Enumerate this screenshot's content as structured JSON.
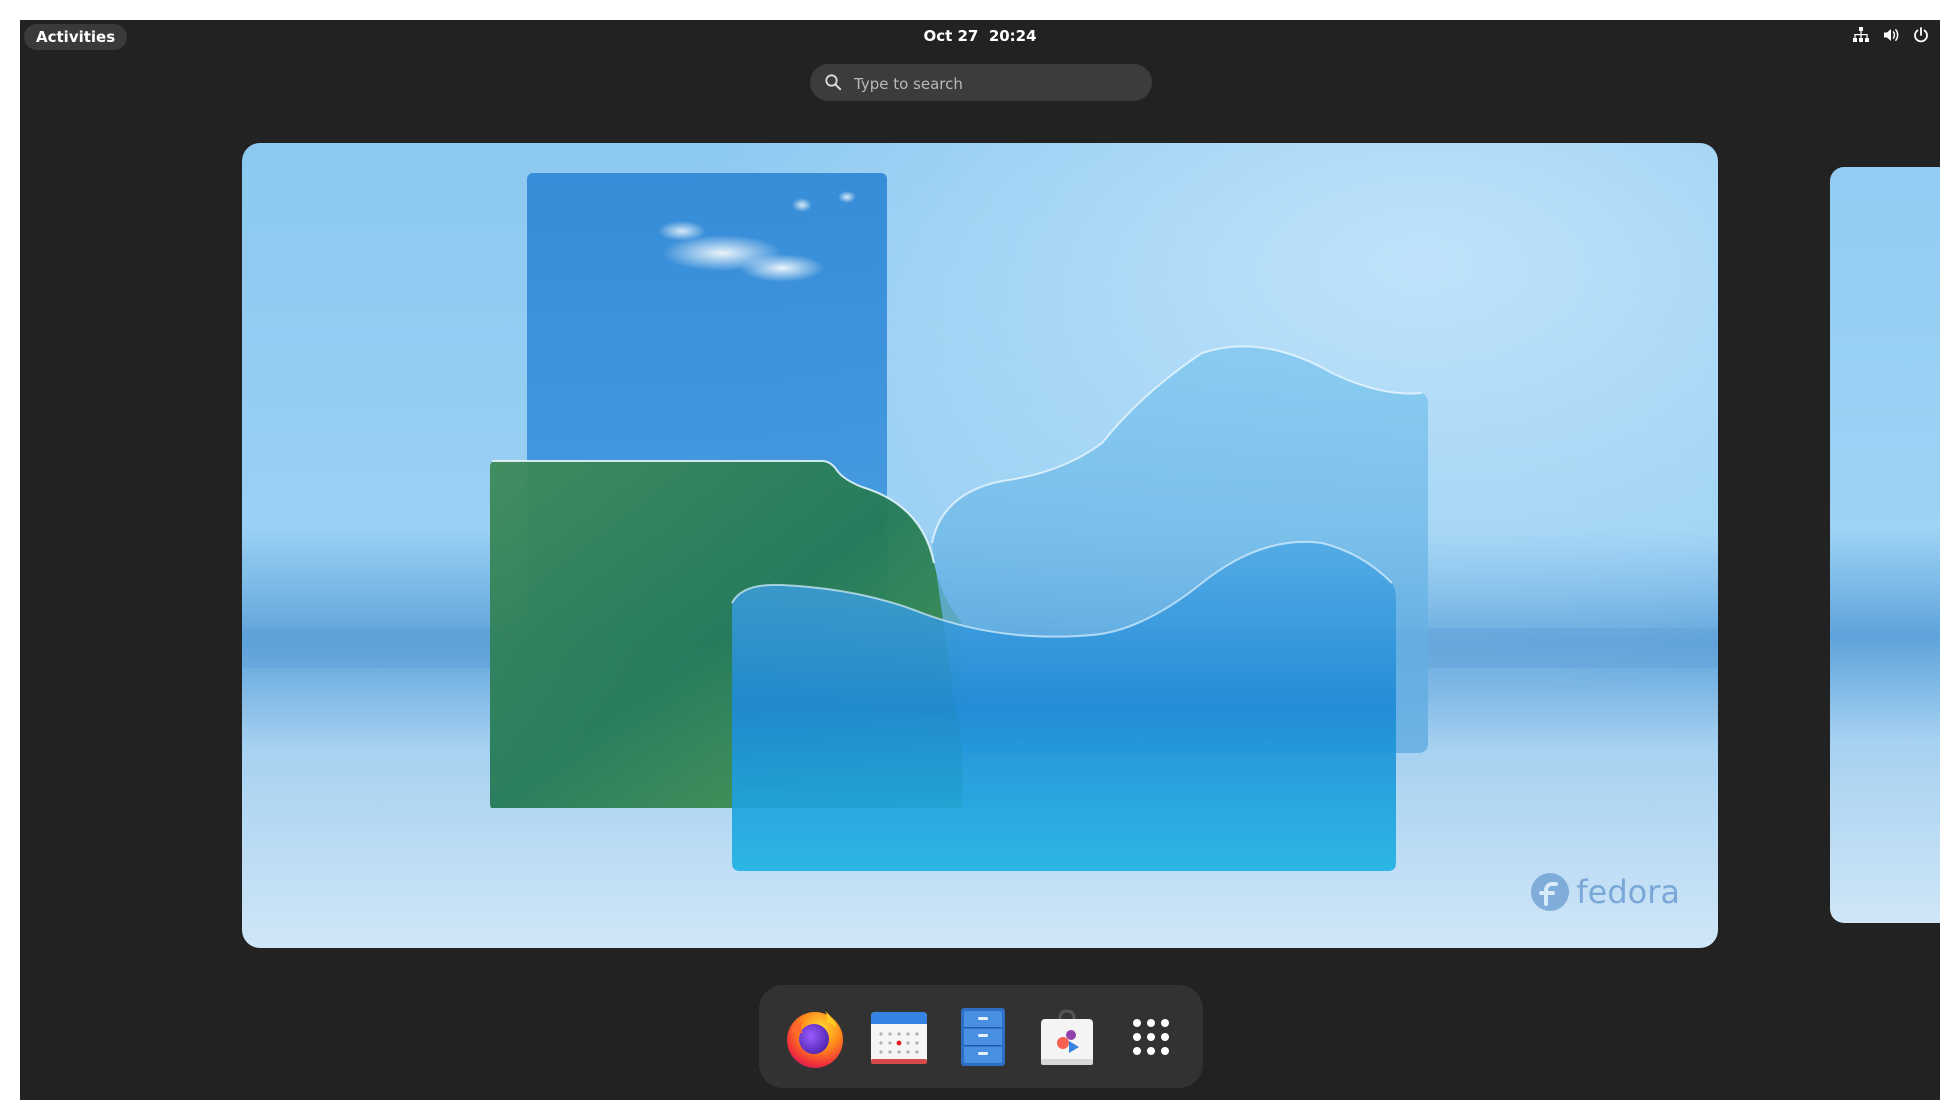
{
  "topbar": {
    "activities_label": "Activities",
    "date": "Oct 27",
    "time": "20:24",
    "tray_icons": [
      "network-icon",
      "volume-icon",
      "power-icon"
    ]
  },
  "search": {
    "placeholder": "Type to search",
    "value": ""
  },
  "workspace": {
    "logo_text": "fedora"
  },
  "dock": {
    "apps": [
      {
        "name": "Firefox",
        "icon": "firefox-icon"
      },
      {
        "name": "Calendar",
        "icon": "calendar-icon"
      },
      {
        "name": "Files",
        "icon": "files-icon"
      },
      {
        "name": "Software",
        "icon": "software-icon"
      },
      {
        "name": "Show Apps",
        "icon": "show-apps-icon"
      }
    ]
  },
  "colors": {
    "panel_bg": "#222222",
    "search_bg": "#3c3c3c",
    "dock_bg": "#323232",
    "accent_blue": "#3584e4"
  }
}
